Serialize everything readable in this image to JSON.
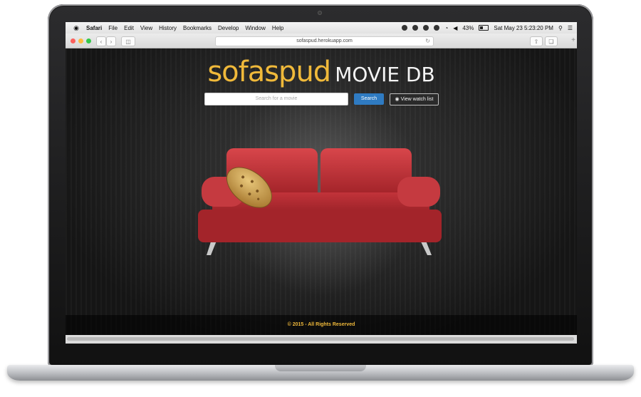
{
  "menubar": {
    "app": "Safari",
    "items": [
      "File",
      "Edit",
      "View",
      "History",
      "Bookmarks",
      "Develop",
      "Window",
      "Help"
    ],
    "battery": "43%",
    "datetime": "Sat May 23  5:23:20 PM"
  },
  "toolbar": {
    "url": "sofaspud.herokuapp.com"
  },
  "page": {
    "brand": "sofaspud",
    "title_suffix": "MOVIE DB",
    "search_placeholder": "Search for a movie",
    "search_button": "Search",
    "watchlist_button": "View watch list",
    "footer": "© 2015 - All Rights Reserved"
  },
  "colors": {
    "brand": "#f0b93a",
    "search_button": "#2f7bc2",
    "couch": "#b32a2f"
  },
  "icons": [
    "apple-icon",
    "back-icon",
    "forward-icon",
    "sidebar-icon",
    "reload-icon",
    "share-icon",
    "tabs-icon",
    "eye-icon",
    "battery-icon",
    "wifi-icon"
  ]
}
